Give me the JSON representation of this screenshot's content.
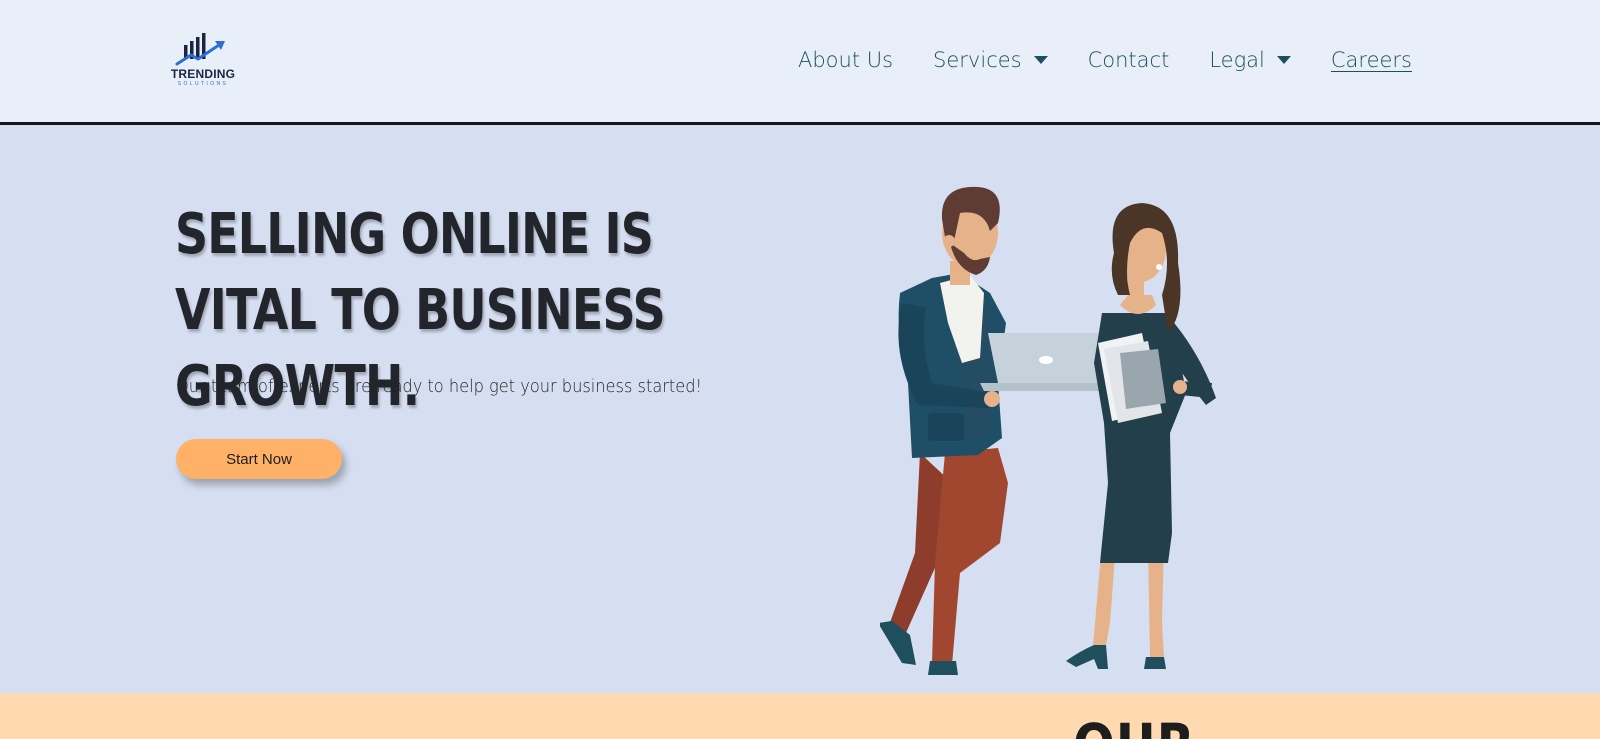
{
  "brand": {
    "name": "TRENDING",
    "tagline": "SOLUTIONS"
  },
  "nav": {
    "items": [
      {
        "label": "About Us",
        "has_dropdown": false
      },
      {
        "label": "Services",
        "has_dropdown": true
      },
      {
        "label": "Contact",
        "has_dropdown": false
      },
      {
        "label": "Legal",
        "has_dropdown": true
      },
      {
        "label": "Careers",
        "has_dropdown": false
      }
    ]
  },
  "hero": {
    "title": "Selling online is vital to business growth.",
    "subtitle": "Our team of experts are ready to help get your business started!",
    "cta_label": "Start Now"
  },
  "next_section": {
    "heading": "OUR"
  },
  "colors": {
    "nav_bg": "#e9eff9",
    "hero_bg": "#d6dff2",
    "accent": "#ffb168",
    "band_bg": "#ffd9b0",
    "nav_text": "#1f4f5c",
    "title_text": "#22262c"
  }
}
